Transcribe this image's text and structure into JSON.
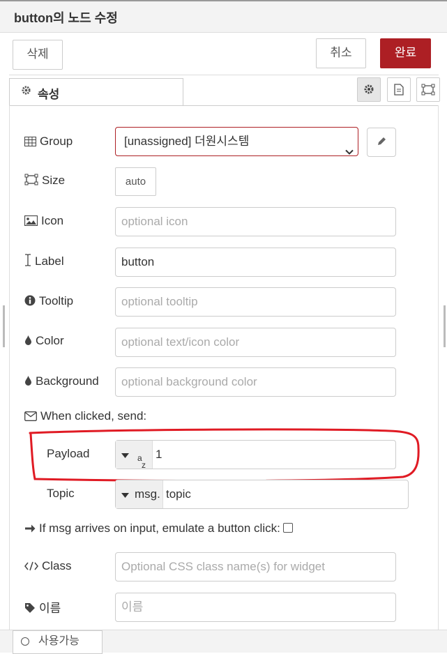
{
  "header": {
    "title": "button의 노드 수정"
  },
  "actions": {
    "delete_label": "삭제",
    "cancel_label": "취소",
    "done_label": "완료",
    "done_color": "#ad1f24"
  },
  "tabs": {
    "properties_label": "속성"
  },
  "tab_icons": [
    "gear-icon",
    "document-icon",
    "layout-icon"
  ],
  "form": {
    "group": {
      "label": "Group",
      "value": "[unassigned] 더원시스템"
    },
    "size": {
      "label": "Size",
      "value": "auto"
    },
    "icon": {
      "label": "Icon",
      "placeholder": "optional icon"
    },
    "label": {
      "label": "Label",
      "value": "button"
    },
    "tooltip": {
      "label": "Tooltip",
      "placeholder": "optional tooltip"
    },
    "color": {
      "label": "Color",
      "placeholder": "optional text/icon color"
    },
    "background": {
      "label": "Background",
      "placeholder": "optional background color"
    },
    "when_clicked": {
      "label": "When clicked, send:"
    },
    "payload": {
      "label": "Payload",
      "type_symbol": "az",
      "value": "1"
    },
    "topic": {
      "label": "Topic",
      "type_prefix": "msg.",
      "value": "topic"
    },
    "emulate": {
      "label": "If msg arrives on input, emulate a button click:",
      "checked": false
    },
    "class": {
      "label": "Class",
      "placeholder": "Optional CSS class name(s) for widget"
    },
    "name": {
      "label": "이름",
      "placeholder": "이름"
    }
  },
  "footer": {
    "enable_label": "사용가능"
  }
}
